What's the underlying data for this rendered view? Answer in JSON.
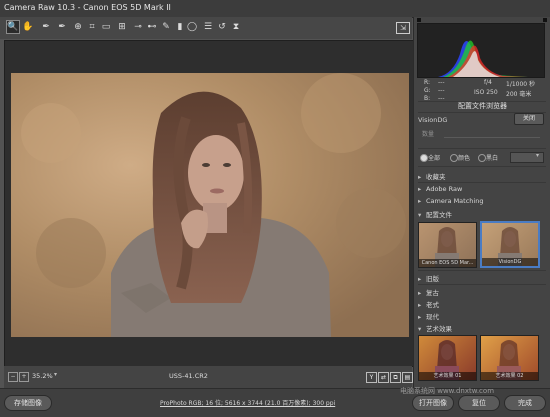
{
  "window": {
    "title": "Camera Raw 10.3 -  Canon EOS 5D Mark II"
  },
  "toolbar": {
    "tools": [
      {
        "name": "zoom-tool-icon",
        "glyph": "🔍"
      },
      {
        "name": "hand-tool-icon",
        "glyph": "✋"
      },
      {
        "name": "white-balance-tool-icon",
        "glyph": "✒"
      },
      {
        "name": "color-sampler-tool-icon",
        "glyph": "✒"
      },
      {
        "name": "targeted-adjustment-tool-icon",
        "glyph": "⊕"
      },
      {
        "name": "crop-tool-icon",
        "glyph": "⌗"
      },
      {
        "name": "straighten-tool-icon",
        "glyph": "▭"
      },
      {
        "name": "transform-tool-icon",
        "glyph": "⊞"
      },
      {
        "name": "spot-removal-tool-icon",
        "glyph": "⊸"
      },
      {
        "name": "red-eye-tool-icon",
        "glyph": "⊷"
      },
      {
        "name": "adjustment-brush-icon",
        "glyph": "✎"
      },
      {
        "name": "graduated-filter-icon",
        "glyph": "▮"
      },
      {
        "name": "radial-filter-icon",
        "glyph": "◯"
      },
      {
        "name": "preferences-icon",
        "glyph": "☰"
      },
      {
        "name": "rotate-left-icon",
        "glyph": "↺"
      },
      {
        "name": "rotate-right-icon",
        "glyph": "⧗"
      }
    ]
  },
  "status": {
    "zoom": "35.2%",
    "filename": "USS-41.CR2"
  },
  "bottom": {
    "save_label": "存储图像",
    "workflow_info": "ProPhoto RGB; 16 位; 5616 x 3744 (21.0 百万像素); 300 ppi",
    "open_label": "打开图像",
    "reset_label": "复位",
    "done_label": "完成"
  },
  "info": {
    "r_label": "R:",
    "g_label": "G:",
    "b_label": "B:",
    "dash": "---",
    "aperture": "f/4",
    "shutter": "1/1000 秒",
    "iso": "ISO 250",
    "focal": "200 毫米"
  },
  "profile_browser": {
    "title": "配置文件浏览器",
    "profile_name": "VisionDG",
    "close_label": "关闭",
    "amount_label": "数量",
    "filters": [
      "全部",
      "颜色",
      "黑白"
    ],
    "groups": [
      {
        "label": "收藏夹"
      },
      {
        "label": "Adobe Raw"
      },
      {
        "label": "Camera Matching"
      },
      {
        "label": "配置文件"
      }
    ],
    "thumbnails_profiles": [
      {
        "label": "Canon EOS 5D Mar..."
      },
      {
        "label": "VisionDG"
      }
    ],
    "groups2": [
      {
        "label": "旧版"
      },
      {
        "label": "复古"
      },
      {
        "label": "老式"
      },
      {
        "label": "现代"
      },
      {
        "label": "艺术效果"
      }
    ],
    "thumbnails_art": [
      {
        "label": "艺术效果 01"
      },
      {
        "label": "艺术效果 02"
      }
    ]
  },
  "watermark": "电脑系统网 www.dnxtw.com"
}
